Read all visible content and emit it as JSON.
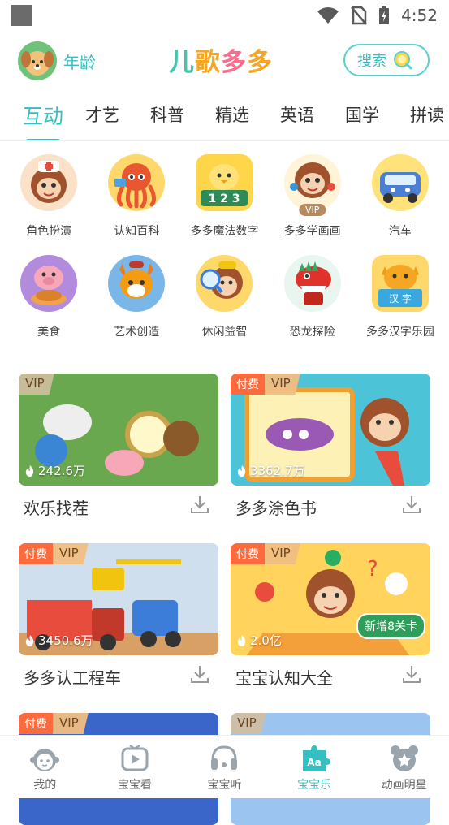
{
  "status_bar": {
    "time": "4:52"
  },
  "header": {
    "age_label": "年龄",
    "logo": [
      "儿",
      "歌",
      "多",
      "多"
    ],
    "search_label": "搜索"
  },
  "tabs": [
    {
      "label": "互动",
      "active": true
    },
    {
      "label": "才艺"
    },
    {
      "label": "科普"
    },
    {
      "label": "精选"
    },
    {
      "label": "英语"
    },
    {
      "label": "国学"
    },
    {
      "label": "拼读"
    }
  ],
  "games": [
    {
      "label": "角色扮演",
      "icon": "monkey-nurse-icon",
      "color": "#fbe1c8"
    },
    {
      "label": "认知百科",
      "icon": "octopus-icon",
      "color": "#ffd86b"
    },
    {
      "label": "多多魔法数字",
      "icon": "chick-numbers-icon",
      "color": "#ffd54a"
    },
    {
      "label": "多多学画画",
      "icon": "monkey-painter-icon",
      "color": "#fff3d8",
      "vip": "VIP"
    },
    {
      "label": "汽车",
      "icon": "car-icon",
      "color": "#ffe37a"
    },
    {
      "label": "美食",
      "icon": "pig-chef-icon",
      "color": "#b38bdc"
    },
    {
      "label": "艺术创造",
      "icon": "fox-artist-icon",
      "color": "#7ab7e8"
    },
    {
      "label": "休闲益智",
      "icon": "monkey-magnifier-icon",
      "color": "#ffd86b"
    },
    {
      "label": "恐龙探险",
      "icon": "dinosaur-icon",
      "color": "#e8f6ef"
    },
    {
      "label": "多多汉字乐园",
      "icon": "cat-book-icon",
      "color": "#ffd86b"
    }
  ],
  "cards": [
    {
      "title": "欢乐找茬",
      "plays": "242.6万",
      "paid": "",
      "vip": "VIP",
      "bg": "#7fb26a"
    },
    {
      "title": "多多涂色书",
      "plays": "3362.7万",
      "paid": "付费",
      "vip": "VIP",
      "bg": "#4cc3d6"
    },
    {
      "title": "多多认工程车",
      "plays": "3450.6万",
      "paid": "付费",
      "vip": "VIP",
      "bg": "#c9d9ea"
    },
    {
      "title": "宝宝认知大全",
      "plays": "2.0亿",
      "paid": "付费",
      "vip": "VIP",
      "bg": "#ffd35c",
      "extra_badge": "新增8关卡"
    },
    {
      "title": "",
      "plays": "",
      "paid": "付费",
      "vip": "VIP",
      "bg": "#3a66c9"
    },
    {
      "title": "",
      "plays": "",
      "paid": "",
      "vip": "VIP",
      "bg": "#9bc4f0"
    }
  ],
  "bottom_nav": [
    {
      "label": "我的",
      "icon": "baby-face-icon"
    },
    {
      "label": "宝宝看",
      "icon": "play-tv-icon"
    },
    {
      "label": "宝宝听",
      "icon": "music-note-icon"
    },
    {
      "label": "宝宝乐",
      "icon": "puzzle-aa-icon",
      "active": true
    },
    {
      "label": "动画明星",
      "icon": "bear-star-icon"
    }
  ]
}
